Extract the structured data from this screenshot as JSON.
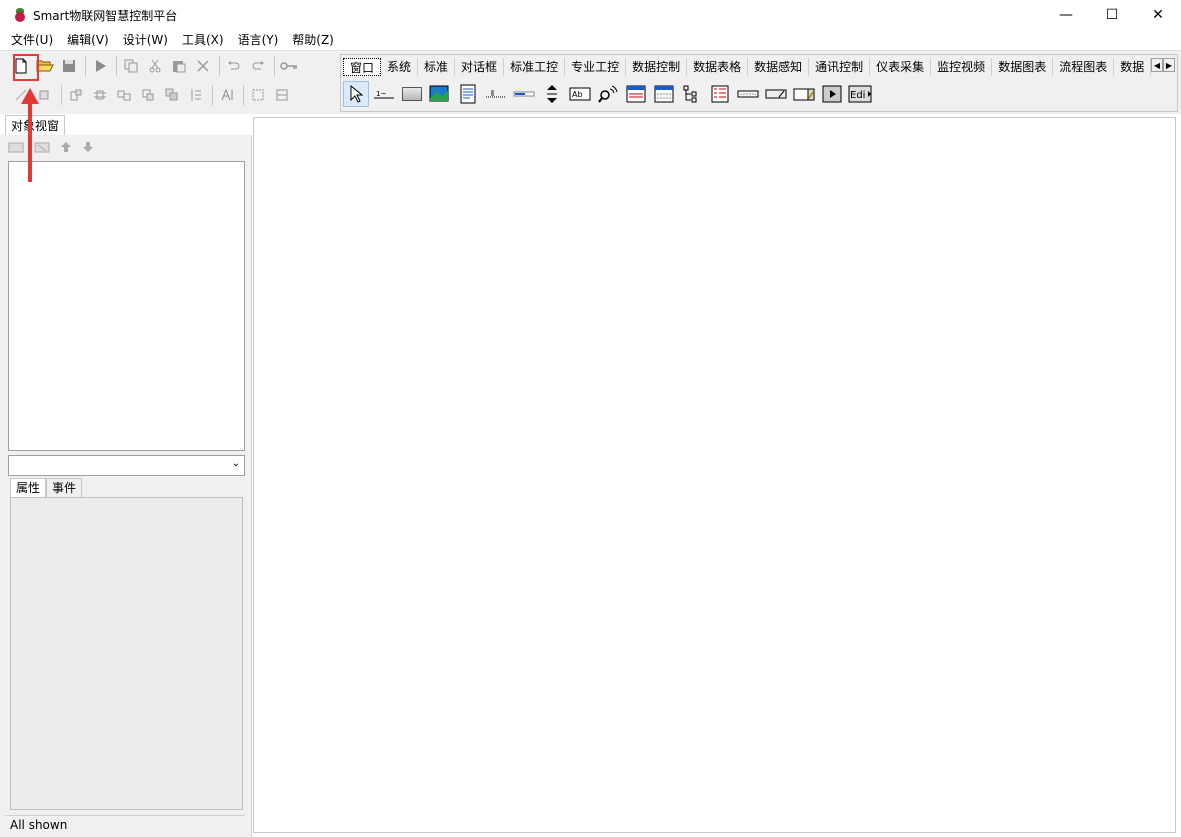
{
  "window": {
    "title": "Smart物联网智慧控制平台",
    "minimize_glyph": "—",
    "maximize_glyph": "☐",
    "close_glyph": "✕"
  },
  "menu": [
    "文件(U)",
    "编辑(V)",
    "设计(W)",
    "工具(X)",
    "语言(Y)",
    "帮助(Z)"
  ],
  "toolbar": {
    "row1": [
      "new-file-icon",
      "open-folder-icon",
      "save-icon",
      "run-icon",
      "copy-icon",
      "cut-icon",
      "paste-icon",
      "delete-icon",
      "undo-icon",
      "redo-icon",
      "key-icon"
    ],
    "row2": [
      "align-icon",
      "align-icon",
      "align-icon",
      "align-icon",
      "align-icon",
      "align-icon",
      "align-icon",
      "text-format-icon",
      "group-icon",
      "ungroup-icon"
    ]
  },
  "palette": {
    "tabs": [
      "窗口",
      "系统",
      "标准",
      "对话框",
      "标准工控",
      "专业工控",
      "数据控制",
      "数据表格",
      "数据感知",
      "通讯控制",
      "仪表采集",
      "监控视频",
      "数据图表",
      "流程图表",
      "数据"
    ],
    "active_tab": "窗口",
    "left_arrow": "◀",
    "right_arrow": "▶"
  },
  "left_panel": {
    "object_tab": "对象视窗",
    "property_tab": "属性",
    "event_tab": "事件",
    "status": "All shown",
    "combo_arrow": "⌄"
  },
  "colors": {
    "annotation": "#e53935",
    "panel_bg": "#f0f0f0"
  }
}
